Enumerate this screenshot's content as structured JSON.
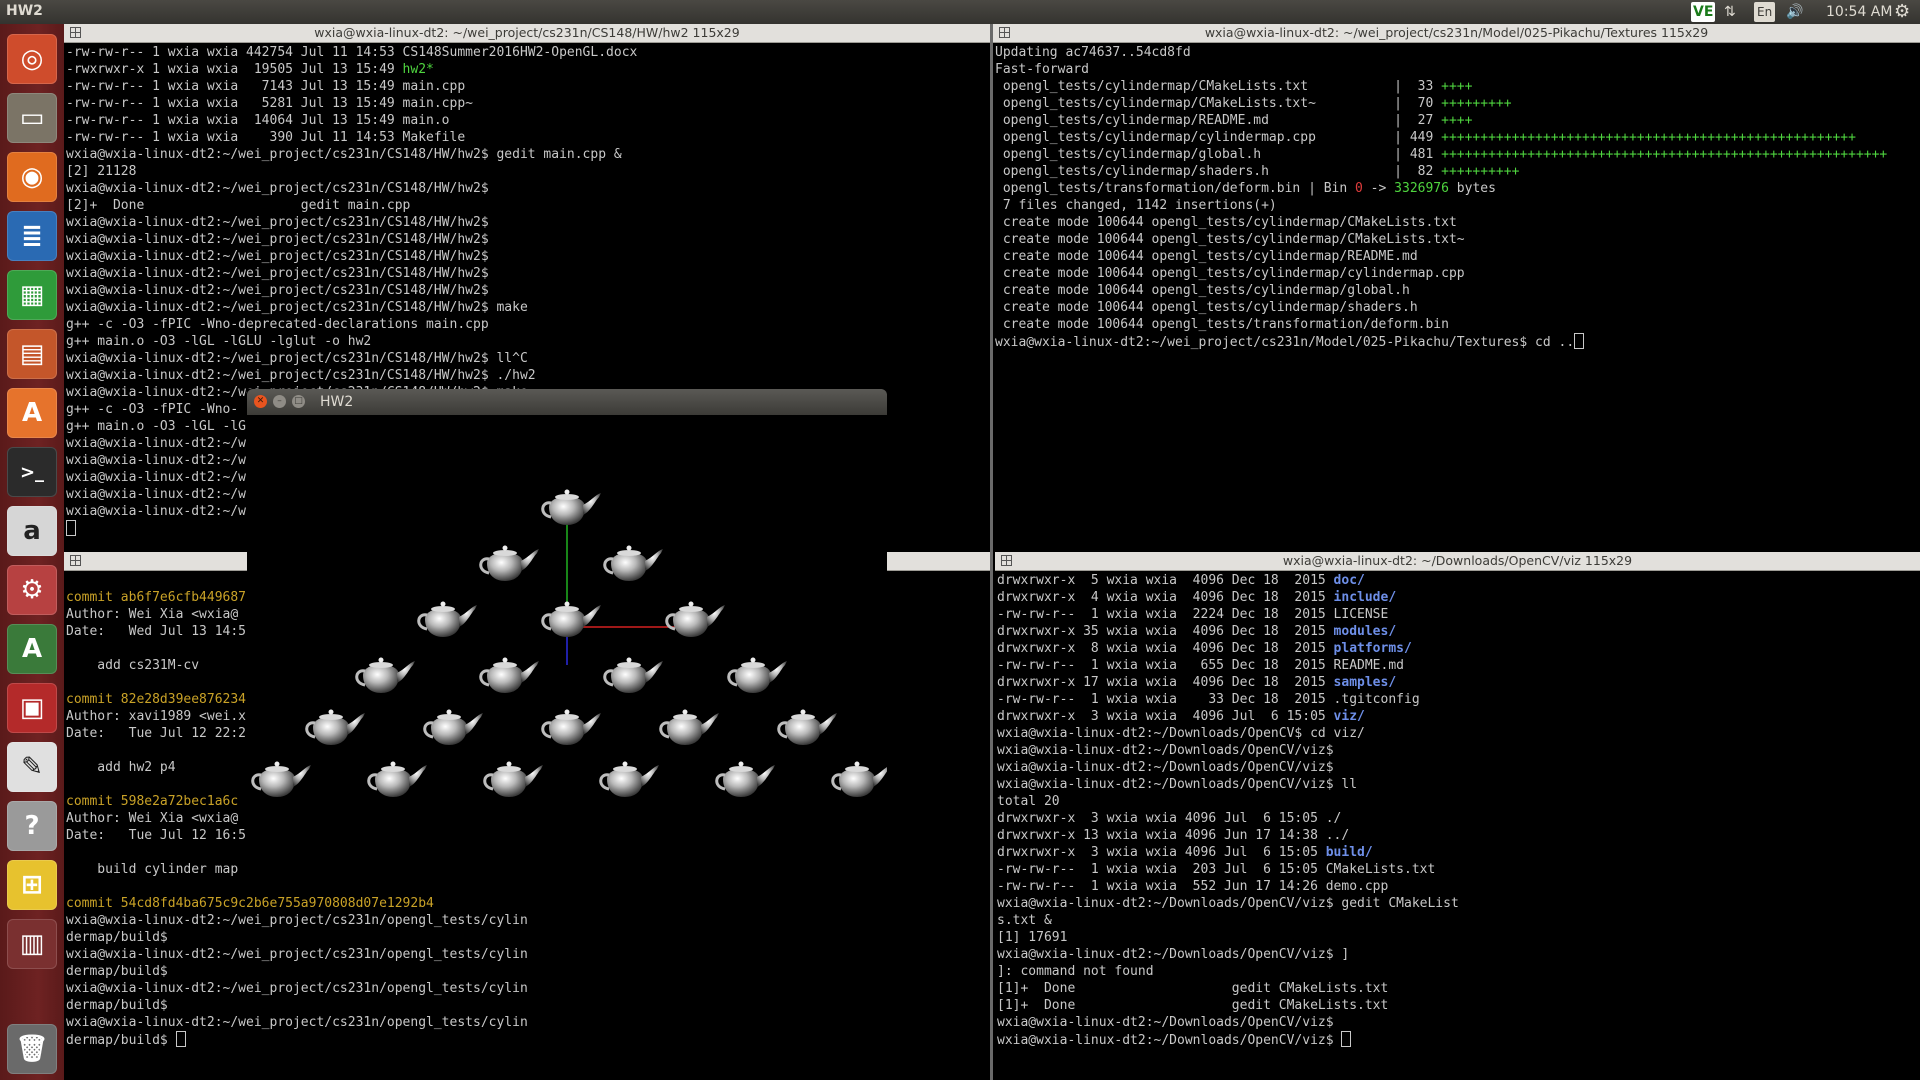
{
  "topbar": {
    "title": "HW2",
    "indicators": [
      "VE",
      "⇅",
      "En",
      "🔊"
    ],
    "clock": "10:54 AM",
    "settings_icon": "gear-icon"
  },
  "launcher": {
    "items": [
      {
        "name": "dash-icon",
        "glyph": "◎",
        "bg": "#cf4c2c"
      },
      {
        "name": "files-icon",
        "glyph": "▭",
        "bg": "#7b7466"
      },
      {
        "name": "firefox-icon",
        "glyph": "◉",
        "bg": "#e06b1f"
      },
      {
        "name": "writer-icon",
        "glyph": "≣",
        "bg": "#2a6ab3"
      },
      {
        "name": "calc-icon",
        "glyph": "▦",
        "bg": "#2f9b3a"
      },
      {
        "name": "impress-icon",
        "glyph": "▤",
        "bg": "#c4562a"
      },
      {
        "name": "software-center-icon",
        "glyph": "A",
        "bg": "#e6732c"
      },
      {
        "name": "terminal-icon",
        "glyph": ">_",
        "bg": "#2b2b2b"
      },
      {
        "name": "amazon-icon",
        "glyph": "a",
        "bg": "#d6d6d6"
      },
      {
        "name": "settings-icon",
        "glyph": "⚙",
        "bg": "#b74141"
      },
      {
        "name": "updater-icon",
        "glyph": "A",
        "bg": "#3a7a3a"
      },
      {
        "name": "workspace-icon",
        "glyph": "▣",
        "bg": "#b42a2a"
      },
      {
        "name": "text-editor-icon",
        "glyph": "✎",
        "bg": "#e0e0e0"
      },
      {
        "name": "help-icon",
        "glyph": "?",
        "bg": "#9a9a9a"
      },
      {
        "name": "network-icon",
        "glyph": "⊞",
        "bg": "#e7c22e"
      },
      {
        "name": "workspaces-icon",
        "glyph": "▥",
        "bg": "#7a3030"
      },
      {
        "name": "trash-icon",
        "glyph": "🗑",
        "bg": "#6a6a6a"
      }
    ]
  },
  "terminals": {
    "top_left": {
      "title": "wxia@wxia-linux-dt2: ~/wei_project/cs231n/CS148/HW/hw2 115x29",
      "lines": [
        [
          {
            "t": "-rw-rw-r-- 1 wxia wxia 442754 Jul 11 14:53 CS148Summer2016HW2-OpenGL.docx"
          }
        ],
        [
          {
            "t": "-rwxrwxr-x 1 wxia wxia  19505 Jul 13 15:49 "
          },
          {
            "t": "hw2*",
            "c": "g"
          }
        ],
        [
          {
            "t": "-rw-rw-r-- 1 wxia wxia   7143 Jul 13 15:49 main.cpp"
          }
        ],
        [
          {
            "t": "-rw-rw-r-- 1 wxia wxia   5281 Jul 13 15:49 main.cpp~"
          }
        ],
        [
          {
            "t": "-rw-rw-r-- 1 wxia wxia  14064 Jul 13 15:49 main.o"
          }
        ],
        [
          {
            "t": "-rw-rw-r-- 1 wxia wxia    390 Jul 11 14:53 Makefile"
          }
        ],
        [
          {
            "t": "wxia@wxia-linux-dt2:~/wei_project/cs231n/CS148/HW/hw2$ gedit main.cpp &"
          }
        ],
        [
          {
            "t": "[2] 21128"
          }
        ],
        [
          {
            "t": "wxia@wxia-linux-dt2:~/wei_project/cs231n/CS148/HW/hw2$"
          }
        ],
        [
          {
            "t": "[2]+  Done                    gedit main.cpp"
          }
        ],
        [
          {
            "t": "wxia@wxia-linux-dt2:~/wei_project/cs231n/CS148/HW/hw2$"
          }
        ],
        [
          {
            "t": "wxia@wxia-linux-dt2:~/wei_project/cs231n/CS148/HW/hw2$"
          }
        ],
        [
          {
            "t": "wxia@wxia-linux-dt2:~/wei_project/cs231n/CS148/HW/hw2$"
          }
        ],
        [
          {
            "t": "wxia@wxia-linux-dt2:~/wei_project/cs231n/CS148/HW/hw2$"
          }
        ],
        [
          {
            "t": "wxia@wxia-linux-dt2:~/wei_project/cs231n/CS148/HW/hw2$"
          }
        ],
        [
          {
            "t": "wxia@wxia-linux-dt2:~/wei_project/cs231n/CS148/HW/hw2$ make"
          }
        ],
        [
          {
            "t": "g++ -c -O3 -fPIC -Wno-deprecated-declarations main.cpp"
          }
        ],
        [
          {
            "t": "g++ main.o -O3 -lGL -lGLU -lglut -o hw2"
          }
        ],
        [
          {
            "t": "wxia@wxia-linux-dt2:~/wei_project/cs231n/CS148/HW/hw2$ ll^C"
          }
        ],
        [
          {
            "t": "wxia@wxia-linux-dt2:~/wei_project/cs231n/CS148/HW/hw2$ ./hw2"
          }
        ],
        [
          {
            "t": "wxia@wxia-linux-dt2:~/wei_project/cs231n/CS148/HW/hw2$ make"
          }
        ],
        [
          {
            "t": "g++ -c -O3 -fPIC -Wno-"
          }
        ],
        [
          {
            "t": "g++ main.o -O3 -lGL -lG"
          }
        ],
        [
          {
            "t": "wxia@wxia-linux-dt2:~/w"
          }
        ],
        [
          {
            "t": "wxia@wxia-linux-dt2:~/w"
          }
        ],
        [
          {
            "t": "wxia@wxia-linux-dt2:~/w"
          }
        ],
        [
          {
            "t": "wxia@wxia-linux-dt2:~/w"
          }
        ],
        [
          {
            "t": "wxia@wxia-linux-dt2:~/w"
          }
        ],
        [
          {
            "t": "",
            "cursor": true
          }
        ]
      ]
    },
    "top_right": {
      "title": "wxia@wxia-linux-dt2: ~/wei_project/cs231n/Model/025-Pikachu/Textures 115x29",
      "lines": [
        [
          {
            "t": "Updating ac74637..54cd8fd"
          }
        ],
        [
          {
            "t": "Fast-forward"
          }
        ],
        [
          {
            "t": " opengl_tests/cylindermap/CMakeLists.txt           |  33 "
          },
          {
            "t": "++++",
            "c": "g"
          }
        ],
        [
          {
            "t": " opengl_tests/cylindermap/CMakeLists.txt~          |  70 "
          },
          {
            "t": "+++++++++",
            "c": "g"
          }
        ],
        [
          {
            "t": " opengl_tests/cylindermap/README.md                |  27 "
          },
          {
            "t": "++++",
            "c": "g"
          }
        ],
        [
          {
            "t": " opengl_tests/cylindermap/cylindermap.cpp          | 449 "
          },
          {
            "t": "+++++++++++++++++++++++++++++++++++++++++++++++++++++",
            "c": "g"
          }
        ],
        [
          {
            "t": " opengl_tests/cylindermap/global.h                 | 481 "
          },
          {
            "t": "+++++++++++++++++++++++++++++++++++++++++++++++++++++++++",
            "c": "g"
          }
        ],
        [
          {
            "t": " opengl_tests/cylindermap/shaders.h                |  82 "
          },
          {
            "t": "++++++++++",
            "c": "g"
          }
        ],
        [
          {
            "t": " opengl_tests/transformation/deform.bin | Bin "
          },
          {
            "t": "0",
            "c": "r"
          },
          {
            "t": " -> "
          },
          {
            "t": "3326976",
            "c": "g"
          },
          {
            "t": " bytes"
          }
        ],
        [
          {
            "t": " 7 files changed, 1142 insertions(+)"
          }
        ],
        [
          {
            "t": " create mode 100644 opengl_tests/cylindermap/CMakeLists.txt"
          }
        ],
        [
          {
            "t": " create mode 100644 opengl_tests/cylindermap/CMakeLists.txt~"
          }
        ],
        [
          {
            "t": " create mode 100644 opengl_tests/cylindermap/README.md"
          }
        ],
        [
          {
            "t": " create mode 100644 opengl_tests/cylindermap/cylindermap.cpp"
          }
        ],
        [
          {
            "t": " create mode 100644 opengl_tests/cylindermap/global.h"
          }
        ],
        [
          {
            "t": " create mode 100644 opengl_tests/cylindermap/shaders.h"
          }
        ],
        [
          {
            "t": " create mode 100644 opengl_tests/transformation/deform.bin"
          }
        ],
        [
          {
            "t": "wxia@wxia-linux-dt2:~/wei_project/cs231n/Model/025-Pikachu/Textures$ cd .."
          },
          {
            "t": "",
            "cursor": true
          }
        ]
      ]
    },
    "bottom_left": {
      "title": "",
      "lines": [
        [
          {
            "t": ""
          }
        ],
        [
          {
            "t": "commit ab6f7e6cfb449687",
            "c": "y"
          }
        ],
        [
          {
            "t": "Author: Wei Xia <wxia@"
          }
        ],
        [
          {
            "t": "Date:   Wed Jul 13 14:5"
          }
        ],
        [
          {
            "t": ""
          }
        ],
        [
          {
            "t": "    add cs231M-cv"
          }
        ],
        [
          {
            "t": ""
          }
        ],
        [
          {
            "t": "commit 82e28d39ee876234",
            "c": "y"
          }
        ],
        [
          {
            "t": "Author: xavi1989 <wei.x"
          }
        ],
        [
          {
            "t": "Date:   Tue Jul 12 22:2"
          }
        ],
        [
          {
            "t": ""
          }
        ],
        [
          {
            "t": "    add hw2 p4"
          }
        ],
        [
          {
            "t": ""
          }
        ],
        [
          {
            "t": "commit 598e2a72bec1a6c",
            "c": "y"
          }
        ],
        [
          {
            "t": "Author: Wei Xia <wxia@"
          }
        ],
        [
          {
            "t": "Date:   Tue Jul 12 16:5"
          }
        ],
        [
          {
            "t": ""
          }
        ],
        [
          {
            "t": "    build cylinder map"
          }
        ],
        [
          {
            "t": ""
          }
        ],
        [
          {
            "t": "commit 54cd8fd4ba675c9c2b6e755a970808d07e1292b4",
            "c": "y"
          }
        ],
        [
          {
            "t": "wxia@wxia-linux-dt2:~/wei_project/cs231n/opengl_tests/cylin"
          }
        ],
        [
          {
            "t": "dermap/build$"
          }
        ],
        [
          {
            "t": "wxia@wxia-linux-dt2:~/wei_project/cs231n/opengl_tests/cylin"
          }
        ],
        [
          {
            "t": "dermap/build$"
          }
        ],
        [
          {
            "t": "wxia@wxia-linux-dt2:~/wei_project/cs231n/opengl_tests/cylin"
          }
        ],
        [
          {
            "t": "dermap/build$"
          }
        ],
        [
          {
            "t": "wxia@wxia-linux-dt2:~/wei_project/cs231n/opengl_tests/cylin"
          }
        ],
        [
          {
            "t": "dermap/build$ "
          },
          {
            "t": "",
            "cursor": true
          }
        ]
      ]
    },
    "bottom_right": {
      "title": "wxia@wxia-linux-dt2: ~/Downloads/OpenCV/viz 115x29",
      "lines": [
        [
          {
            "t": "drwxrwxr-x  5 wxia wxia  4096 Dec 18  2015 "
          },
          {
            "t": "doc/",
            "c": "b"
          }
        ],
        [
          {
            "t": "drwxrwxr-x  4 wxia wxia  4096 Dec 18  2015 "
          },
          {
            "t": "include/",
            "c": "b"
          }
        ],
        [
          {
            "t": "-rw-rw-r--  1 wxia wxia  2224 Dec 18  2015 LICENSE"
          }
        ],
        [
          {
            "t": "drwxrwxr-x 35 wxia wxia  4096 Dec 18  2015 "
          },
          {
            "t": "modules/",
            "c": "b"
          }
        ],
        [
          {
            "t": "drwxrwxr-x  8 wxia wxia  4096 Dec 18  2015 "
          },
          {
            "t": "platforms/",
            "c": "b"
          }
        ],
        [
          {
            "t": "-rw-rw-r--  1 wxia wxia   655 Dec 18  2015 README.md"
          }
        ],
        [
          {
            "t": "drwxrwxr-x 17 wxia wxia  4096 Dec 18  2015 "
          },
          {
            "t": "samples/",
            "c": "b"
          }
        ],
        [
          {
            "t": "-rw-rw-r--  1 wxia wxia    33 Dec 18  2015 .tgitconfig"
          }
        ],
        [
          {
            "t": "drwxrwxr-x  3 wxia wxia  4096 Jul  6 15:05 "
          },
          {
            "t": "viz/",
            "c": "b"
          }
        ],
        [
          {
            "t": "wxia@wxia-linux-dt2:~/Downloads/OpenCV$ cd viz/"
          }
        ],
        [
          {
            "t": "wxia@wxia-linux-dt2:~/Downloads/OpenCV/viz$"
          }
        ],
        [
          {
            "t": "wxia@wxia-linux-dt2:~/Downloads/OpenCV/viz$"
          }
        ],
        [
          {
            "t": "wxia@wxia-linux-dt2:~/Downloads/OpenCV/viz$ ll"
          }
        ],
        [
          {
            "t": "total 20"
          }
        ],
        [
          {
            "t": "drwxrwxr-x  3 wxia wxia 4096 Jul  6 15:05 ./"
          }
        ],
        [
          {
            "t": "drwxrwxr-x 13 wxia wxia 4096 Jun 17 14:38 ../"
          }
        ],
        [
          {
            "t": "drwxrwxr-x  3 wxia wxia 4096 Jul  6 15:05 "
          },
          {
            "t": "build/",
            "c": "b"
          }
        ],
        [
          {
            "t": "-rw-rw-r--  1 wxia wxia  203 Jul  6 15:05 CMakeLists.txt"
          }
        ],
        [
          {
            "t": "-rw-rw-r--  1 wxia wxia  552 Jun 17 14:26 demo.cpp"
          }
        ],
        [
          {
            "t": "wxia@wxia-linux-dt2:~/Downloads/OpenCV/viz$ gedit CMakeList"
          }
        ],
        [
          {
            "t": "s.txt &"
          }
        ],
        [
          {
            "t": "[1] 17691"
          }
        ],
        [
          {
            "t": "wxia@wxia-linux-dt2:~/Downloads/OpenCV/viz$ ]"
          }
        ],
        [
          {
            "t": "]: command not found"
          }
        ],
        [
          {
            "t": "[1]+  Done                    gedit CMakeLists.txt"
          }
        ],
        [
          {
            "t": "[1]+  Done                    gedit CMakeLists.txt"
          }
        ],
        [
          {
            "t": "wxia@wxia-linux-dt2:~/Downloads/OpenCV/viz$"
          }
        ],
        [
          {
            "t": "wxia@wxia-linux-dt2:~/Downloads/OpenCV/viz$ "
          },
          {
            "t": "",
            "cursor": true
          }
        ]
      ]
    }
  },
  "glut_window": {
    "title": "HW2",
    "buttons": [
      "close",
      "minimize",
      "maximize"
    ],
    "teapot_rows": [
      1,
      2,
      3,
      4,
      5,
      6
    ],
    "axis_colors": {
      "x": "#d42020",
      "y": "#21b321",
      "z": "#2a2ae0"
    }
  }
}
